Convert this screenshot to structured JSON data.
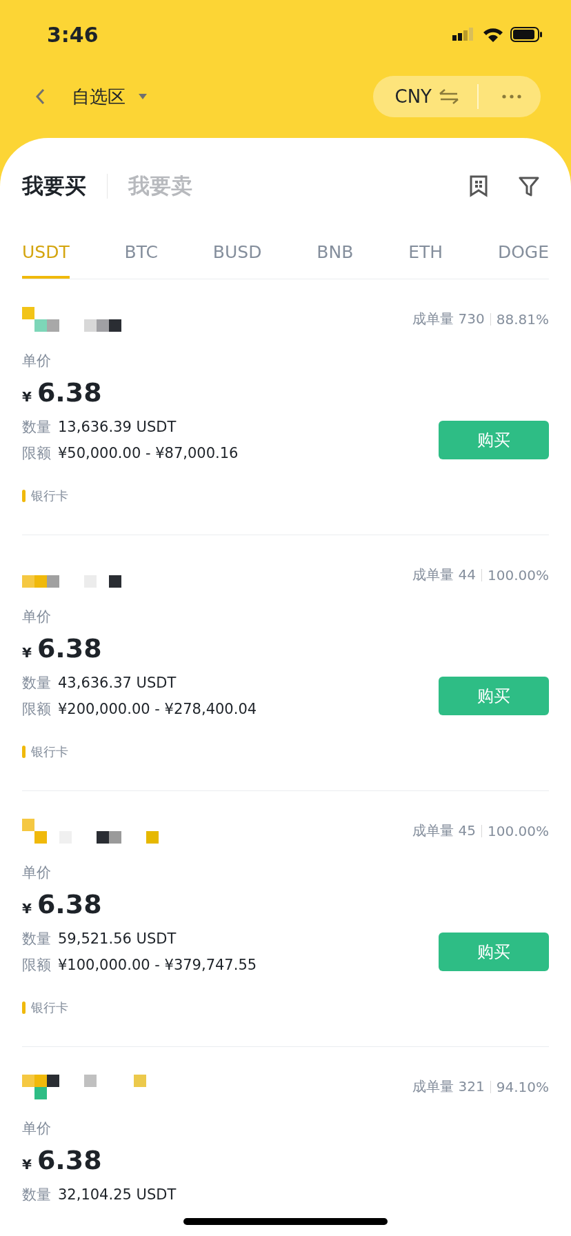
{
  "status_bar": {
    "time": "3:46"
  },
  "nav": {
    "title": "自选区",
    "currency": "CNY"
  },
  "trade_tabs": [
    {
      "label": "我要买",
      "selected": true
    },
    {
      "label": "我要卖",
      "selected": false
    }
  ],
  "coin_tabs": [
    {
      "label": "USDT",
      "selected": true
    },
    {
      "label": "BTC",
      "selected": false
    },
    {
      "label": "BUSD",
      "selected": false
    },
    {
      "label": "BNB",
      "selected": false
    },
    {
      "label": "ETH",
      "selected": false
    },
    {
      "label": "DOGE",
      "selected": false
    }
  ],
  "ads": [
    {
      "orders_label": "成单量",
      "orders": "730",
      "completion": "88.81%",
      "price_label": "单价",
      "currency_symbol": "¥",
      "price": "6.38",
      "quantity_label": "数量",
      "quantity": "13,636.39 USDT",
      "limit_label": "限额",
      "limit": "¥50,000.00 - ¥87,000.16",
      "button": "购买",
      "payment": "银行卡"
    },
    {
      "orders_label": "成单量",
      "orders": "44",
      "completion": "100.00%",
      "price_label": "单价",
      "currency_symbol": "¥",
      "price": "6.38",
      "quantity_label": "数量",
      "quantity": "43,636.37 USDT",
      "limit_label": "限额",
      "limit": "¥200,000.00 - ¥278,400.04",
      "button": "购买",
      "payment": "银行卡"
    },
    {
      "orders_label": "成单量",
      "orders": "45",
      "completion": "100.00%",
      "price_label": "单价",
      "currency_symbol": "¥",
      "price": "6.38",
      "quantity_label": "数量",
      "quantity": "59,521.56 USDT",
      "limit_label": "限额",
      "limit": "¥100,000.00 - ¥379,747.55",
      "button": "购买",
      "payment": "银行卡"
    },
    {
      "orders_label": "成单量",
      "orders": "321",
      "completion": "94.10%",
      "price_label": "单价",
      "currency_symbol": "¥",
      "price": "6.38",
      "quantity_label": "数量",
      "quantity": "32,104.25 USDT"
    }
  ]
}
